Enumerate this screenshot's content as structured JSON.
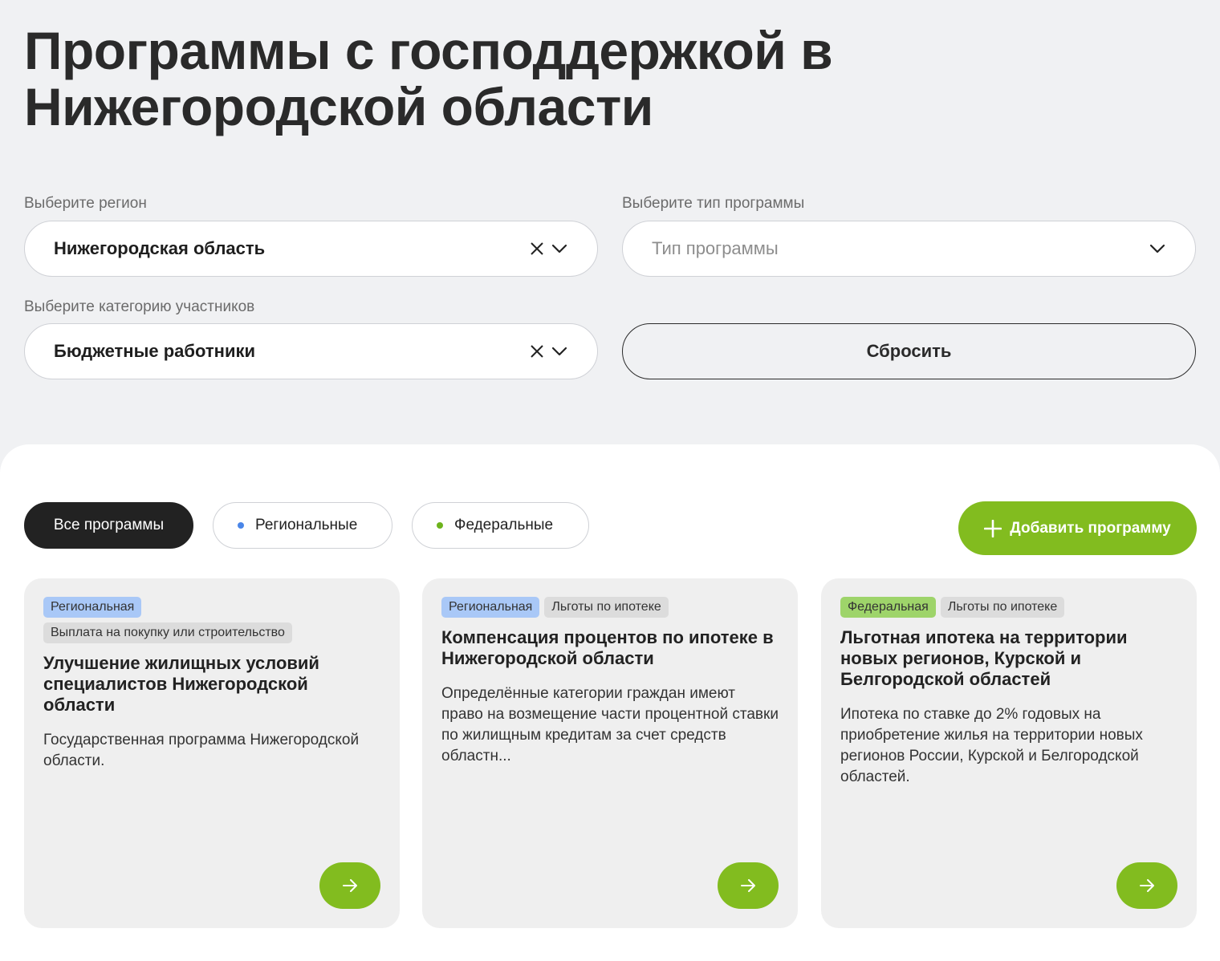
{
  "page": {
    "title": "Программы с господдержкой в Нижегородской области"
  },
  "filters": {
    "region": {
      "label": "Выберите регион",
      "value": "Нижегородская область"
    },
    "program_type": {
      "label": "Выберите тип программы",
      "placeholder": "Тип программы"
    },
    "category": {
      "label": "Выберите категорию участников",
      "value": "Бюджетные работники"
    },
    "reset_label": "Сбросить"
  },
  "tabs": {
    "all": "Все программы",
    "regional": "Региональные",
    "federal": "Федеральные"
  },
  "add_program_label": "Добавить программу",
  "colors": {
    "accent_green": "#82bc1f",
    "regional_dot": "#4a86e8",
    "federal_dot": "#6db31c",
    "regional_tag": "#a9c8f7",
    "federal_tag": "#9ed46a"
  },
  "cards": [
    {
      "tags": [
        "Региональная",
        "Выплата на покупку или строительство"
      ],
      "title": "Улучшение жилищных условий специалистов Нижегородской области",
      "description": "Государственная программа Нижегородской области."
    },
    {
      "tags": [
        "Региональная",
        "Льготы по ипотеке"
      ],
      "title": "Компенсация процентов по ипотеке в Нижегородской области",
      "description": "Определённые категории граждан имеют право на возмещение части процентной ставки по жилищным кредитам за счет средств областн..."
    },
    {
      "tags": [
        "Федеральная",
        "Льготы по ипотеке"
      ],
      "title": "Льготная ипотека на территории новых регионов, Курской и Белгородской областей",
      "description": "Ипотека по ставке до 2% годовых на приобретение жилья на территории новых регионов России, Курской и Белгородской областей."
    }
  ]
}
